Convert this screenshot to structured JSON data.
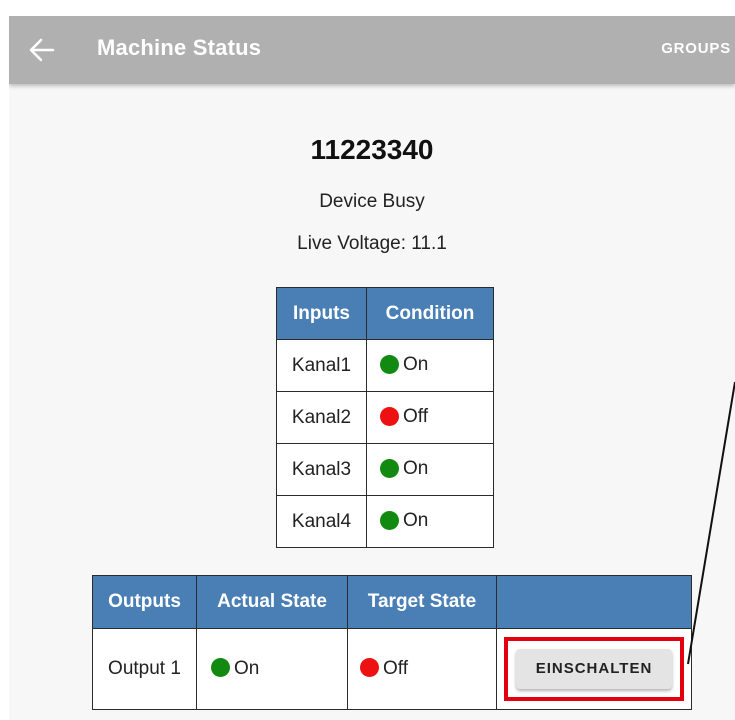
{
  "appbar": {
    "title": "Machine Status",
    "action": "GROUPS",
    "back_icon": "arrow-left-icon"
  },
  "device": {
    "id": "11223340",
    "status": "Device Busy",
    "voltage_label": "Live Voltage: 11.1"
  },
  "inputs_table": {
    "headers": [
      "Inputs",
      "Condition"
    ],
    "rows": [
      {
        "name": "Kanal1",
        "condition": "On",
        "color": "#128a12"
      },
      {
        "name": "Kanal2",
        "condition": "Off",
        "color": "#ee1111"
      },
      {
        "name": "Kanal3",
        "condition": "On",
        "color": "#128a12"
      },
      {
        "name": "Kanal4",
        "condition": "On",
        "color": "#128a12"
      }
    ]
  },
  "outputs_table": {
    "headers": [
      "Outputs",
      "Actual State",
      "Target State",
      ""
    ],
    "rows": [
      {
        "name": "Output 1",
        "actual": "On",
        "actual_color": "#128a12",
        "target": "Off",
        "target_color": "#ee1111",
        "button": "EINSCHALTEN"
      }
    ]
  },
  "colors": {
    "header_bg": "#4a7fb5",
    "appbar_bg": "#b0b0b0",
    "highlight": "#e3000f"
  }
}
